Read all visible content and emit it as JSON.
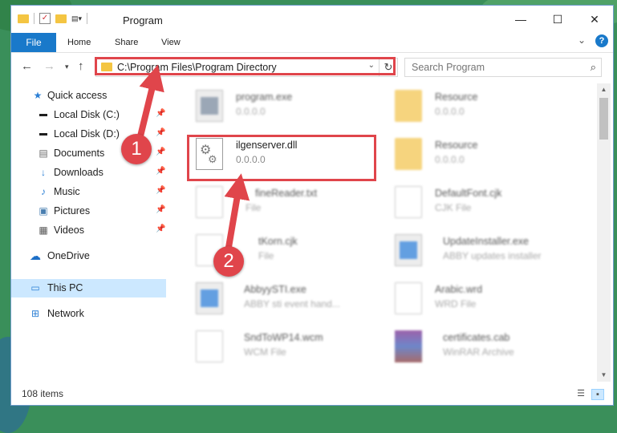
{
  "window": {
    "title": "Program",
    "controls": [
      "—",
      "☐",
      "✕"
    ]
  },
  "ribbon": {
    "tabs": [
      "File",
      "Home",
      "Share",
      "View"
    ],
    "expand_glyph": "⌄",
    "help_glyph": "?"
  },
  "nav": {
    "address": "C:\\Program Files\\Program Directory",
    "search_placeholder": "Search Program"
  },
  "sidebar": {
    "items": [
      {
        "label": "Quick access",
        "icon": "star-icon"
      },
      {
        "label": "Local Disk (C:)",
        "icon": "drive-icon"
      },
      {
        "label": "Local Disk (D:)",
        "icon": "drive-icon"
      },
      {
        "label": "Documents",
        "icon": "documents-icon"
      },
      {
        "label": "Downloads",
        "icon": "download-icon"
      },
      {
        "label": "Music",
        "icon": "music-icon"
      },
      {
        "label": "Pictures",
        "icon": "pictures-icon"
      },
      {
        "label": "Videos",
        "icon": "videos-icon"
      },
      {
        "label": "OneDrive",
        "icon": "cloud-icon"
      },
      {
        "label": "This PC",
        "icon": "computer-icon"
      },
      {
        "label": "Network",
        "icon": "network-icon"
      }
    ]
  },
  "files": [
    {
      "name": "program.exe",
      "sub": "0.0.0.0",
      "icon": "app-icon"
    },
    {
      "name": "Resource",
      "sub": "0.0.0.0",
      "icon": "folder-icon"
    },
    {
      "name": "ilgenserver.dll",
      "sub": "0.0.0.0",
      "icon": "dll-gear-icon"
    },
    {
      "name": "Resource",
      "sub": "0.0.0.0",
      "icon": "folder-icon"
    },
    {
      "name": "fineReader.txt",
      "sub": "File",
      "icon": "document-icon"
    },
    {
      "name": "DefaultFont.cjk",
      "sub": "CJK File",
      "icon": "document-icon"
    },
    {
      "name": "tKorn.cjk",
      "sub": "File",
      "icon": "document-icon"
    },
    {
      "name": "UpdateInstaller.exe",
      "sub": "ABBY updates installer",
      "icon": "installer-icon"
    },
    {
      "name": "AbbyySTI.exe",
      "sub": "ABBY sti event hand...",
      "icon": "app-icon"
    },
    {
      "name": "Arabic.wrd",
      "sub": "WRD File",
      "icon": "document-icon"
    },
    {
      "name": "SndToWP14.wcm",
      "sub": "WCM File",
      "icon": "document-icon"
    },
    {
      "name": "certificates.cab",
      "sub": "WinRAR Archive",
      "icon": "winrar-icon"
    }
  ],
  "status": {
    "item_count": "108 items"
  },
  "annotations": {
    "marker_1": "1",
    "marker_2": "2",
    "highlight_color": "#e0454b"
  }
}
